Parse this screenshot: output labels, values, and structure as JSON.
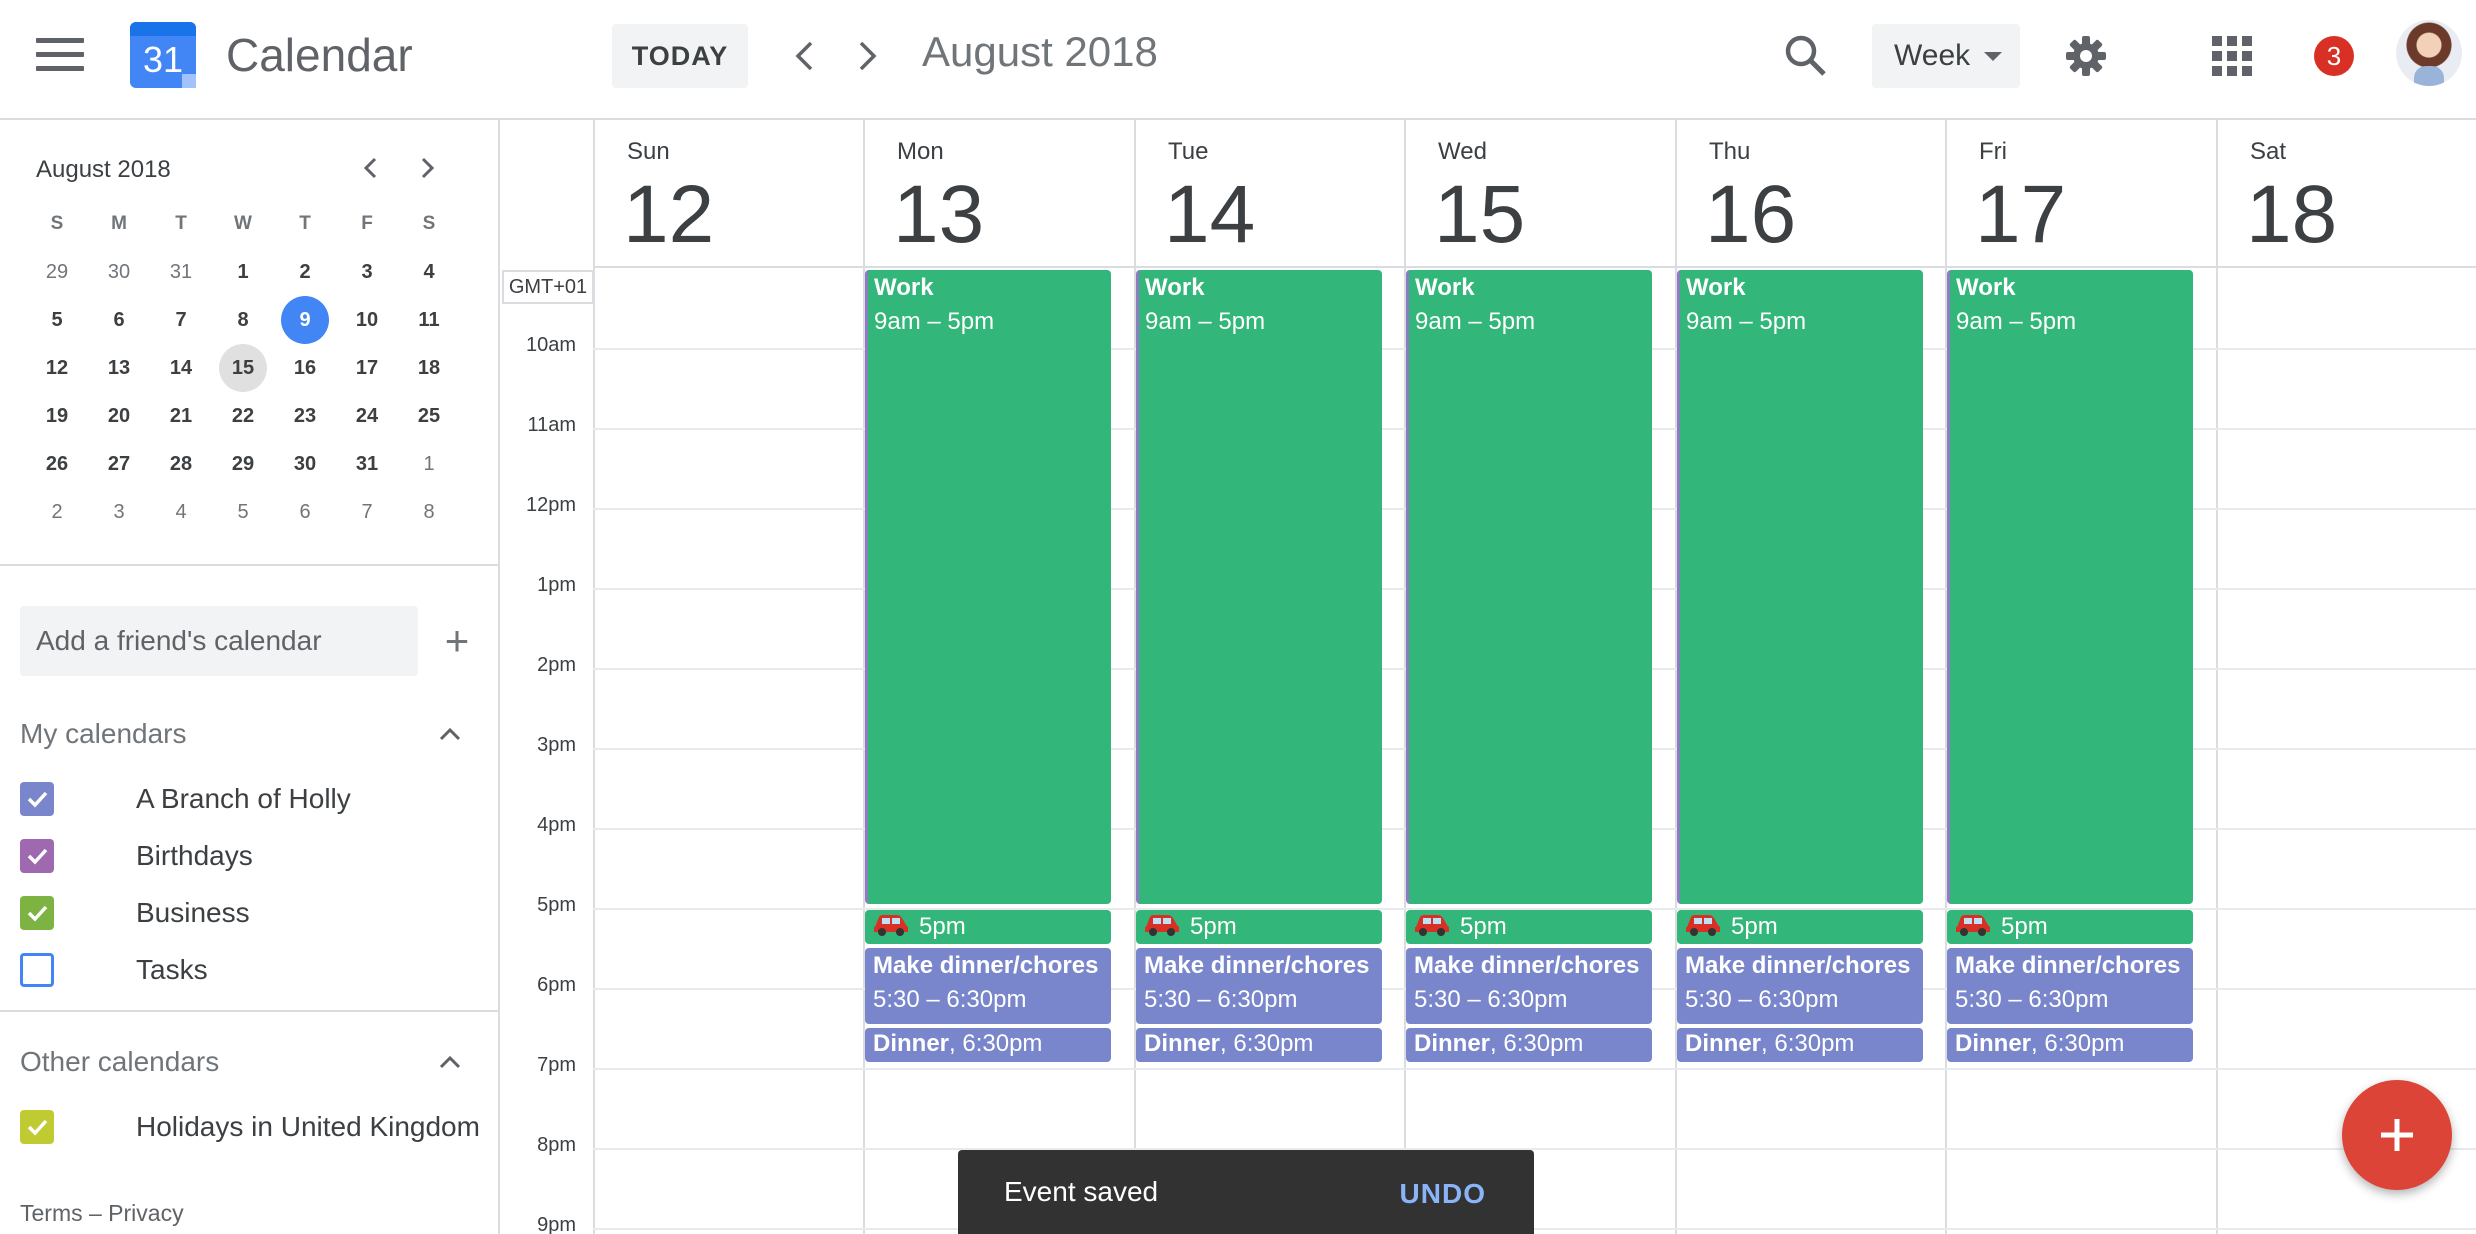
{
  "header": {
    "app_name": "Calendar",
    "logo_day": "31",
    "today_label": "TODAY",
    "title": "August 2018",
    "view_label": "Week",
    "notification_count": "3"
  },
  "mini_month": {
    "title": "August 2018",
    "weekdays": [
      "S",
      "M",
      "T",
      "W",
      "T",
      "F",
      "S"
    ],
    "weeks": [
      [
        "29",
        "30",
        "31",
        "1",
        "2",
        "3",
        "4"
      ],
      [
        "5",
        "6",
        "7",
        "8",
        "9",
        "10",
        "11"
      ],
      [
        "12",
        "13",
        "14",
        "15",
        "16",
        "17",
        "18"
      ],
      [
        "19",
        "20",
        "21",
        "22",
        "23",
        "24",
        "25"
      ],
      [
        "26",
        "27",
        "28",
        "29",
        "30",
        "31",
        "1"
      ],
      [
        "2",
        "3",
        "4",
        "5",
        "6",
        "7",
        "8"
      ]
    ],
    "selected": "9",
    "current": "15"
  },
  "sidebar": {
    "friend_placeholder": "Add a friend's calendar",
    "my_calendars_label": "My calendars",
    "my_calendars": [
      {
        "label": "A Branch of Holly",
        "color": "#7986cb",
        "checked": true
      },
      {
        "label": "Birthdays",
        "color": "#9e69af",
        "checked": true
      },
      {
        "label": "Business",
        "color": "#7cb342",
        "checked": true
      },
      {
        "label": "Tasks",
        "color": "#4285f4",
        "checked": false
      }
    ],
    "other_calendars_label": "Other calendars",
    "other_calendars": [
      {
        "label": "Holidays in United Kingdom",
        "color": "#c0ca33",
        "checked": true
      }
    ],
    "footer": "Terms – Privacy"
  },
  "week": {
    "timezone": "GMT+01",
    "days": [
      {
        "name": "Sun",
        "num": "12"
      },
      {
        "name": "Mon",
        "num": "13"
      },
      {
        "name": "Tue",
        "num": "14"
      },
      {
        "name": "Wed",
        "num": "15"
      },
      {
        "name": "Thu",
        "num": "16"
      },
      {
        "name": "Fri",
        "num": "17"
      },
      {
        "name": "Sat",
        "num": "18"
      }
    ],
    "hours": [
      "10am",
      "11am",
      "12pm",
      "1pm",
      "2pm",
      "3pm",
      "4pm",
      "5pm",
      "6pm",
      "7pm",
      "8pm",
      "9pm"
    ],
    "work": {
      "title": "Work",
      "time": "9am – 5pm"
    },
    "drive": {
      "icon": "car-icon",
      "label": "5pm"
    },
    "chores": {
      "title": "Make dinner/chores",
      "time": "5:30 – 6:30pm"
    },
    "dinner": {
      "title": "Dinner",
      "time": ", 6:30pm"
    }
  },
  "toast": {
    "message": "Event saved",
    "action": "UNDO"
  },
  "colors": {
    "work": "#33b679",
    "personal": "#7986cb",
    "accent": "#4285f4",
    "fab": "#db4437"
  }
}
